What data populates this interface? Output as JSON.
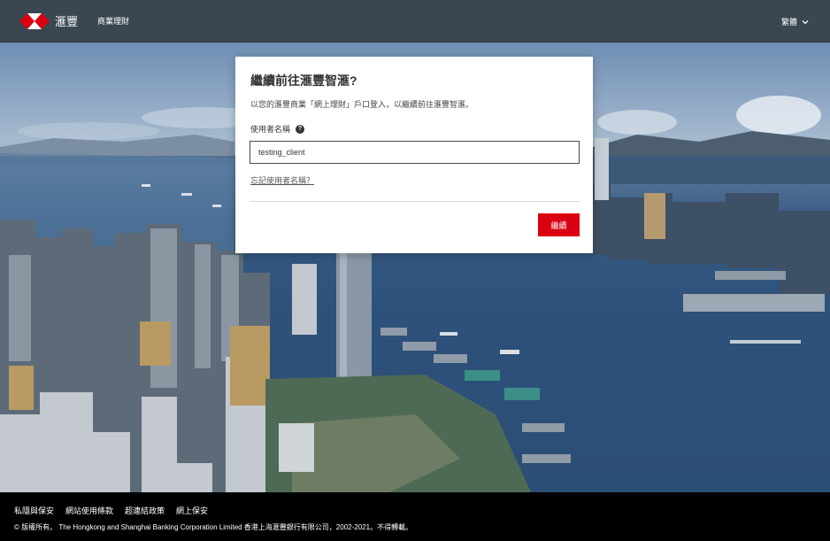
{
  "header": {
    "brand_name": "滙豐",
    "nav_business": "商業理財",
    "language": "繁體"
  },
  "login_card": {
    "title": "繼續前往滙豐智滙?",
    "description": "以您的滙豐商業「網上理財」戶口登入，以繼續前往滙豐智滙。",
    "username_label": "使用者名稱",
    "username_value": "testing_client",
    "forgot_username": "忘記使用者名稱？",
    "continue_label": "繼續"
  },
  "footer": {
    "links": [
      "私隱與保安",
      "網站使用條款",
      "超連結政策",
      "網上保安"
    ],
    "copyright": "© 版權所有。 The Hongkong and Shanghai Banking Corporation Limited 香港上海滙豐銀行有限公司，2002-2021。不得轉載。"
  },
  "colors": {
    "header_bg": "#3b4750",
    "brand_red": "#db0011",
    "footer_bg": "#000000"
  },
  "icons": {
    "logo": "hsbc-hexagon-logo-icon",
    "language_dropdown": "chevron-down-icon",
    "help": "question-circle-icon"
  }
}
